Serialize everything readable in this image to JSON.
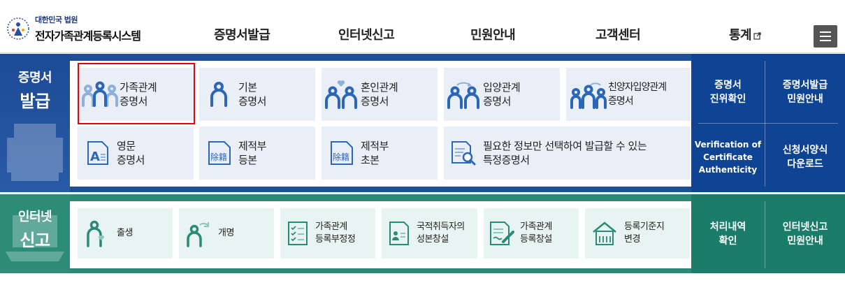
{
  "header": {
    "logo_sub": "대한민국 법원",
    "logo_main": "전자가족관계등록시스템",
    "nav": [
      "증명서발급",
      "인터넷신고",
      "민원안내",
      "고객센터",
      "통계"
    ]
  },
  "certificates": {
    "title_line1": "증명서",
    "title_line2": "발급",
    "tiles": [
      {
        "line1": "가족관계",
        "line2": "증명서",
        "icon": "family-icon"
      },
      {
        "line1": "기본",
        "line2": "증명서",
        "icon": "person-icon"
      },
      {
        "line1": "혼인관계",
        "line2": "증명서",
        "icon": "couple-heart-icon"
      },
      {
        "line1": "입양관계",
        "line2": "증명서",
        "icon": "adoption-icon"
      },
      {
        "line1": "친양자입양관계",
        "line2": "증명서",
        "icon": "family-adoption-icon"
      },
      {
        "line1": "영문",
        "line2": "증명서",
        "icon": "english-doc-icon"
      },
      {
        "line1": "제적부",
        "line2": "등본",
        "icon": "removed-register-icon"
      },
      {
        "line1": "제적부",
        "line2": "초본",
        "icon": "removed-register-icon"
      },
      {
        "line1": "필요한 정보만 선택하여 발급할 수 있는",
        "line2": "특정증명서",
        "icon": "search-doc-icon"
      }
    ],
    "stamp": "除籍",
    "side": [
      {
        "line1": "증명서",
        "line2": "진위확인"
      },
      {
        "line1": "증명서발급",
        "line2": "민원안내"
      },
      {
        "line1": "Verification of",
        "line2": "Certificate",
        "line3": "Authenticity"
      },
      {
        "line1": "신청서양식",
        "line2": "다운로드"
      }
    ]
  },
  "report": {
    "title_line1": "인터넷",
    "title_line2": "신고",
    "tiles": [
      {
        "line1": "출생",
        "line2": "",
        "icon": "birth-icon"
      },
      {
        "line1": "개명",
        "line2": "",
        "icon": "rename-icon"
      },
      {
        "line1": "가족관계",
        "line2": "등록부정정",
        "icon": "checklist-icon"
      },
      {
        "line1": "국적취득자의",
        "line2": "성본창설",
        "icon": "id-card-icon"
      },
      {
        "line1": "가족관계",
        "line2": "등록창설",
        "icon": "document-pen-icon"
      },
      {
        "line1": "등록기준지",
        "line2": "변경",
        "icon": "house-icon"
      }
    ],
    "side": [
      {
        "line1": "처리내역",
        "line2": "확인"
      },
      {
        "line1": "인터넷신고",
        "line2": "민원안내"
      }
    ]
  },
  "colors": {
    "blue": "#1f4e99",
    "green": "#2a8a76",
    "icon_blue": "#2b67b8",
    "icon_green": "#2a8a76",
    "highlight": "#e3000f"
  }
}
